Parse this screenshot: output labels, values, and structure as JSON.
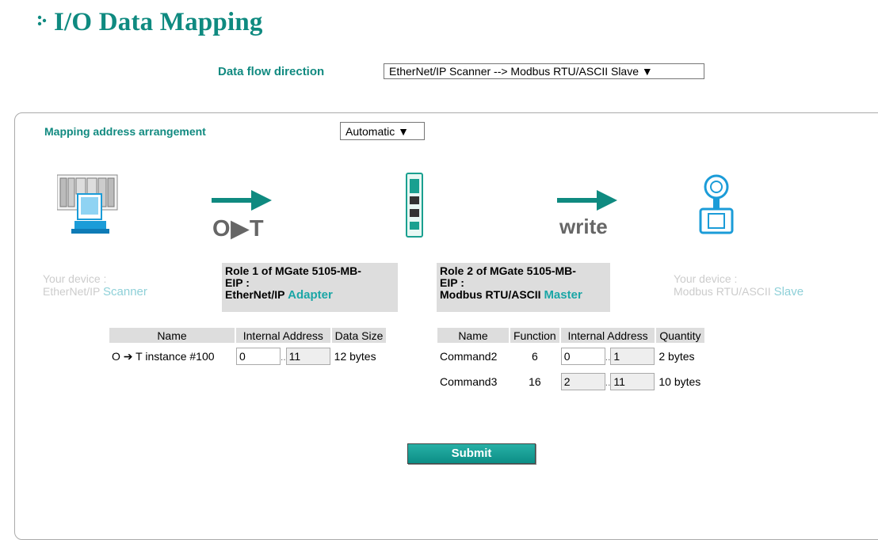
{
  "page": {
    "title": "I/O Data Mapping"
  },
  "flow": {
    "label": "Data flow direction",
    "value": "EtherNet/IP Scanner --> Modbus RTU/ASCII Slave ▼"
  },
  "mapping": {
    "label": "Mapping address arrangement",
    "value": "Automatic ▼"
  },
  "icons": {
    "scanner": "plc-computer-icon",
    "arrow1": "arrow-right-icon",
    "gateway": "mgate-device-icon",
    "arrow2": "arrow-right-icon",
    "slave": "flowmeter-icon"
  },
  "arrow1_caption": "O▶T",
  "arrow2_caption": "write",
  "left_device": {
    "line1": "Your device :",
    "line2a": "EtherNet/IP ",
    "line2b": "Scanner"
  },
  "role1": {
    "line1": "Role 1 of MGate 5105-MB-",
    "line2": "EIP :",
    "line3a": "EtherNet/IP ",
    "line3b": "Adapter"
  },
  "role2": {
    "line1": "Role 2 of MGate 5105-MB-",
    "line2": "EIP :",
    "line3a": "Modbus RTU/ASCII ",
    "line3b": "Master"
  },
  "right_device": {
    "line1": "Your device :",
    "line2a": "Modbus RTU/ASCII ",
    "line2b": "Slave"
  },
  "left_table": {
    "headers": [
      "Name",
      "Internal Address",
      "Data Size"
    ],
    "rows": [
      {
        "name": "O ➔ T instance #100",
        "from": "0",
        "to": "11",
        "size": "12 bytes"
      }
    ]
  },
  "right_table": {
    "headers": [
      "Name",
      "Function",
      "Internal Address",
      "Quantity"
    ],
    "rows": [
      {
        "name": "Command2",
        "function": "6",
        "from": "0",
        "to": "1",
        "qty": "2 bytes"
      },
      {
        "name": "Command3",
        "function": "16",
        "from": "2",
        "to": "11",
        "qty": "10 bytes"
      }
    ]
  },
  "range_sep": "..",
  "submit_label": "Submit",
  "colors": {
    "accent": "#0f8a80",
    "muted_blue": "#8ed0d8"
  }
}
